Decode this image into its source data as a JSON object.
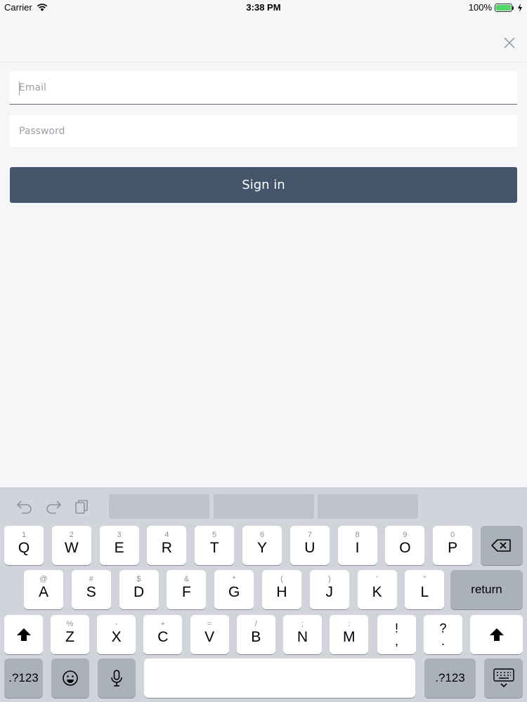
{
  "status": {
    "carrier": "Carrier",
    "time": "3:38 PM",
    "battery": "100%"
  },
  "form": {
    "email_placeholder": "Email",
    "password_placeholder": "Password",
    "signin_label": "Sign in"
  },
  "keyboard": {
    "row1": [
      {
        "hint": "1",
        "main": "Q"
      },
      {
        "hint": "2",
        "main": "W"
      },
      {
        "hint": "3",
        "main": "E"
      },
      {
        "hint": "4",
        "main": "R"
      },
      {
        "hint": "5",
        "main": "T"
      },
      {
        "hint": "6",
        "main": "Y"
      },
      {
        "hint": "7",
        "main": "U"
      },
      {
        "hint": "8",
        "main": "I"
      },
      {
        "hint": "9",
        "main": "O"
      },
      {
        "hint": "0",
        "main": "P"
      }
    ],
    "row2": [
      {
        "hint": "@",
        "main": "A"
      },
      {
        "hint": "#",
        "main": "S"
      },
      {
        "hint": "$",
        "main": "D"
      },
      {
        "hint": "&",
        "main": "F"
      },
      {
        "hint": "*",
        "main": "G"
      },
      {
        "hint": "(",
        "main": "H"
      },
      {
        "hint": ")",
        "main": "J"
      },
      {
        "hint": "'",
        "main": "K"
      },
      {
        "hint": "\"",
        "main": "L"
      }
    ],
    "row3": [
      {
        "hint": "%",
        "main": "Z"
      },
      {
        "hint": "-",
        "main": "X"
      },
      {
        "hint": "+",
        "main": "C"
      },
      {
        "hint": "=",
        "main": "V"
      },
      {
        "hint": "/",
        "main": "B"
      },
      {
        "hint": ";",
        "main": "N"
      },
      {
        "hint": ":",
        "main": "M"
      }
    ],
    "punct1": {
      "top": "!",
      "bottom": ","
    },
    "punct2": {
      "top": "?",
      "bottom": "."
    },
    "return_label": "return",
    "numbers_label": ".?123"
  }
}
